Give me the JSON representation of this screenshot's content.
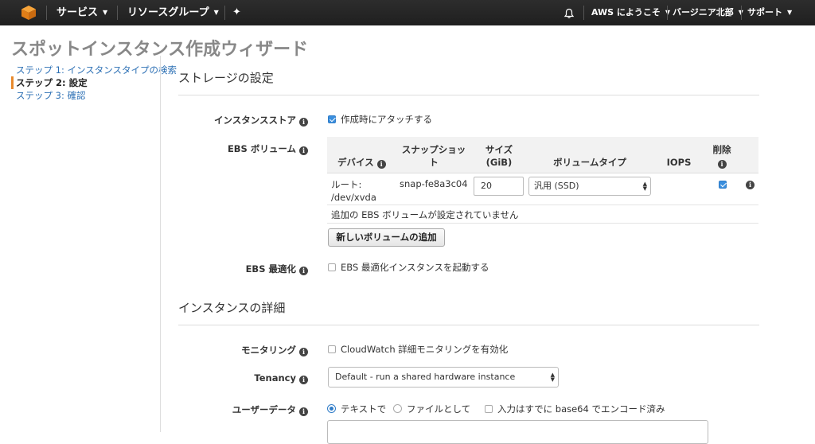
{
  "nav": {
    "services": "サービス",
    "resource_groups": "リソースグループ",
    "welcome": "AWS にようこそ",
    "region": "バージニア北部",
    "support": "サポート",
    "icons": {
      "logo": "aws-cube-icon",
      "pin": "pin-icon",
      "bell": "bell-icon"
    }
  },
  "page": {
    "title": "スポットインスタンス作成ウィザード"
  },
  "steps": [
    {
      "label": "ステップ 1: インスタンスタイプの検索"
    },
    {
      "label": "ステップ 2: 設定"
    },
    {
      "label": "ステップ 3: 確認"
    }
  ],
  "storage": {
    "section_title": "ストレージの設定",
    "instance_store_label": "インスタンスストア",
    "instance_store_checkbox": "作成時にアタッチする",
    "instance_store_checked": true,
    "ebs_label": "EBS ボリューム",
    "table_headers": {
      "device": "デバイス",
      "snapshot": "スナップショット",
      "size": "サイズ\n(GiB)",
      "volume_type": "ボリュームタイプ",
      "iops": "IOPS",
      "delete": "削除"
    },
    "root_row": {
      "device": "ルート:\n/dev/xvda",
      "snapshot": "snap-fe8a3c04",
      "size": "20",
      "volume_type": "汎用 (SSD)",
      "delete_checked": true
    },
    "no_additional": "追加の EBS ボリュームが設定されていません",
    "add_volume_button": "新しいボリュームの追加",
    "ebs_optimized_label": "EBS 最適化",
    "ebs_optimized_checkbox": "EBS 最適化インスタンスを起動する",
    "ebs_optimized_checked": false
  },
  "details": {
    "section_title": "インスタンスの詳細",
    "monitoring_label": "モニタリング",
    "monitoring_checkbox": "CloudWatch 詳細モニタリングを有効化",
    "monitoring_checked": false,
    "tenancy_label": "Tenancy",
    "tenancy_value": "Default - run a shared hardware instance",
    "userdata_label": "ユーザーデータ",
    "userdata_options": [
      "テキストで",
      "ファイルとして"
    ],
    "userdata_selected": "テキストで",
    "base64_checkbox": "入力はすでに base64 でエンコード済み",
    "base64_checked": false
  },
  "colors": {
    "nav_bg": "#232323",
    "accent": "#e88a2d",
    "link": "#2b6fb4",
    "checkbox": "#3b8fde"
  }
}
